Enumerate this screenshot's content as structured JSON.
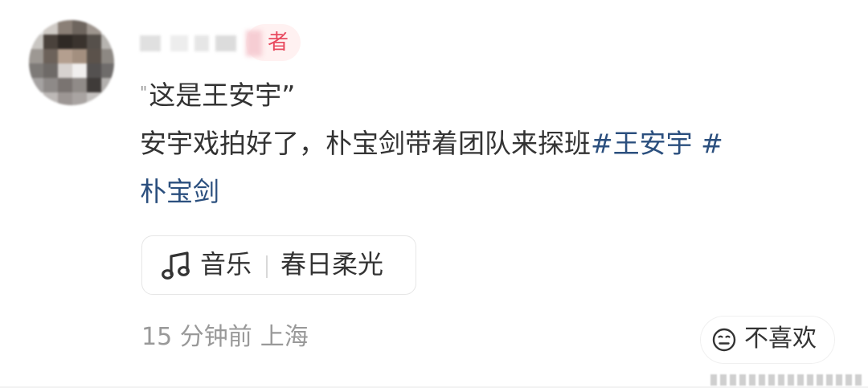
{
  "post": {
    "author_badge": "者",
    "quote_mark": "\"",
    "quote_text": "这是王安宇”",
    "body_line_1_text": "安宇戏拍好了，朴宝剑带着团队来探班",
    "tag_1": "#王安宇 #",
    "tag_2": "朴宝剑"
  },
  "music": {
    "icon": "music-note-icon",
    "label": "音乐",
    "title": "春日柔光"
  },
  "meta": {
    "time": "15 分钟前",
    "location": "上海"
  },
  "actions": {
    "dislike_icon": "neutral-face-icon",
    "dislike_label": "不喜欢"
  },
  "colors": {
    "text": "#333333",
    "muted": "#999999",
    "tag": "#2b4f7e",
    "badge_text": "#e84a5f",
    "badge_bg": "#fff1f1"
  }
}
